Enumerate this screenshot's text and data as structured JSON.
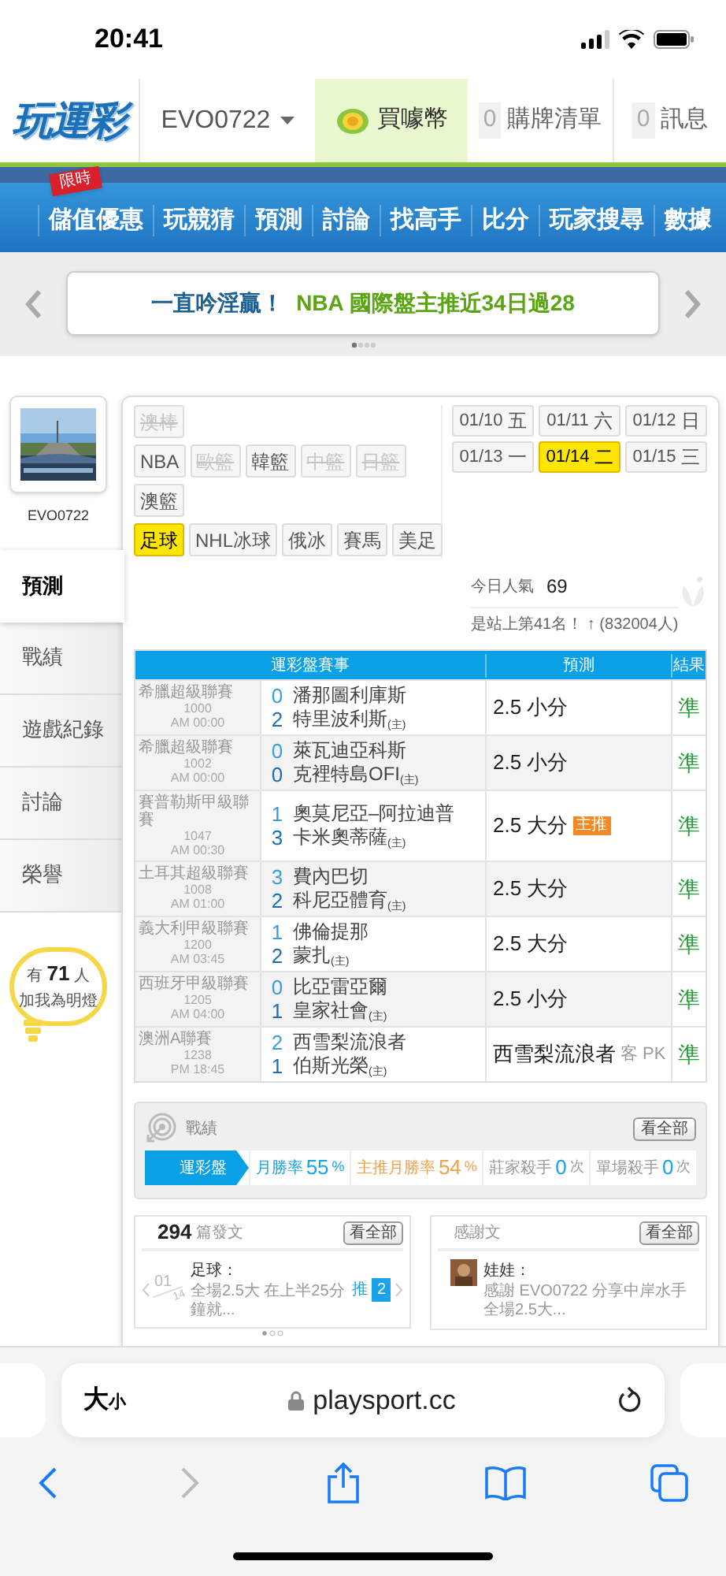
{
  "status_bar": {
    "time": "20:41"
  },
  "header": {
    "logo": "玩運彩",
    "user": "EVO0722",
    "buy": "買噱幣",
    "cart": {
      "count": "0",
      "label": "購牌清單"
    },
    "messages": {
      "count": "0",
      "label": "訊息"
    }
  },
  "nav": {
    "badge": "限時",
    "items": [
      "儲值優惠",
      "玩競猜",
      "預測",
      "討論",
      "找高手",
      "比分",
      "玩家搜尋",
      "數據"
    ]
  },
  "banner": {
    "lead": "一直吟淫贏！",
    "text": "NBA 國際盤主推近34日過28"
  },
  "profile": {
    "name": "EVO0722"
  },
  "sidebar": {
    "items": [
      {
        "label": "預測",
        "selected": true
      },
      {
        "label": "戰績",
        "selected": false
      },
      {
        "label": "遊戲紀錄",
        "selected": false
      },
      {
        "label": "討論",
        "selected": false
      },
      {
        "label": "榮譽",
        "selected": false
      }
    ],
    "fans": {
      "prefix": "有",
      "count": "71",
      "suffix": "人",
      "line2": "加我為明燈"
    }
  },
  "sports": {
    "rows": [
      [
        {
          "label": "澳棒",
          "disabled": true,
          "selected": false
        }
      ],
      [
        {
          "label": "NBA",
          "disabled": false,
          "selected": false
        },
        {
          "label": "歐籃",
          "disabled": true,
          "selected": false
        },
        {
          "label": "韓籃",
          "disabled": false,
          "selected": false
        },
        {
          "label": "中籃",
          "disabled": true,
          "selected": false
        },
        {
          "label": "日籃",
          "disabled": true,
          "selected": false
        }
      ],
      [
        {
          "label": "澳籃",
          "disabled": false,
          "selected": false
        }
      ],
      [
        {
          "label": "足球",
          "disabled": false,
          "selected": true
        },
        {
          "label": "NHL冰球",
          "disabled": false,
          "selected": false
        },
        {
          "label": "俄冰",
          "disabled": false,
          "selected": false
        },
        {
          "label": "賽馬",
          "disabled": false,
          "selected": false
        },
        {
          "label": "美足",
          "disabled": false,
          "selected": false
        }
      ]
    ]
  },
  "dates": [
    {
      "date": "01/10",
      "day": "五",
      "selected": false
    },
    {
      "date": "01/11",
      "day": "六",
      "selected": false
    },
    {
      "date": "01/12",
      "day": "日",
      "selected": false
    },
    {
      "date": "01/13",
      "day": "一",
      "selected": false
    },
    {
      "date": "01/14",
      "day": "二",
      "selected": true
    },
    {
      "date": "01/15",
      "day": "三",
      "selected": false
    }
  ],
  "popularity": {
    "label": "今日人氣",
    "value": "69",
    "rank": "是站上第41名！ ↑ (832004人)"
  },
  "table": {
    "columns": [
      "運彩盤賽事",
      "預測",
      "結果"
    ],
    "rows": [
      {
        "league": "希臘超級聯賽",
        "code": "1000",
        "time": "AM 00:00",
        "scores": [
          "0",
          "2"
        ],
        "teams": [
          "潘那圖利庫斯",
          "特里波利斯$_{(主)}$"
        ],
        "pick": "2.5 小分",
        "result": "準"
      },
      {
        "league": "希臘超級聯賽",
        "code": "1002",
        "time": "AM 00:00",
        "scores": [
          "0",
          "0"
        ],
        "teams": [
          "萊瓦迪亞科斯",
          "克裡特島OFI$_{(主)}$"
        ],
        "pick": "2.5 小分",
        "result": "準"
      },
      {
        "league": "賽普勒斯甲級聯賽",
        "code": "1047",
        "time": "AM 00:30",
        "scores": [
          "1",
          "3"
        ],
        "teams": [
          "奧莫尼亞–阿拉迪普",
          "卡米奧蒂薩$_{(主)}$"
        ],
        "pick": "2.5 大分",
        "badge": "主推",
        "result": "準"
      },
      {
        "league": "土耳其超級聯賽",
        "code": "1008",
        "time": "AM 01:00",
        "scores": [
          "3",
          "2"
        ],
        "teams": [
          "費內巴切",
          "科尼亞體育$_{(主)}$"
        ],
        "pick": "2.5 大分",
        "result": "準"
      },
      {
        "league": "義大利甲級聯賽",
        "code": "1200",
        "time": "AM 03:45",
        "scores": [
          "1",
          "2"
        ],
        "teams": [
          "佛倫提那",
          "蒙扎$_{(主)}$"
        ],
        "pick": "2.5 大分",
        "result": "準"
      },
      {
        "league": "西班牙甲級聯賽",
        "code": "1205",
        "time": "AM 04:00",
        "scores": [
          "0",
          "1"
        ],
        "teams": [
          "比亞雷亞爾",
          "皇家社會$_{(主)}$"
        ],
        "pick": "2.5 小分",
        "result": "準"
      },
      {
        "league": "澳洲A聯賽",
        "code": "1238",
        "time": "PM 18:45",
        "scores": [
          "2",
          "1"
        ],
        "teams": [
          "西雪梨流浪者",
          "伯斯光榮$_{(主)}$"
        ],
        "pick": "西雪梨流浪者",
        "note": "客 PK",
        "result": "準"
      }
    ]
  },
  "record": {
    "title": "戰績",
    "view_all": "看全部",
    "tab": "運彩盤",
    "stats": [
      {
        "kind": "highlight",
        "label": "月勝率",
        "value": "55",
        "unit": "%",
        "color": "#1aa3e8"
      },
      {
        "kind": "highlight",
        "label": "主推月勝率",
        "value": "54",
        "unit": "%",
        "color": "#f5a04a"
      },
      {
        "kind": "plain",
        "label": "莊家殺手",
        "value": "0",
        "unit": "次",
        "color": "#1aa3e8"
      },
      {
        "kind": "plain",
        "label": "單場殺手",
        "value": "0",
        "unit": "次",
        "color": "#1aa3e8"
      }
    ]
  },
  "posts": {
    "count": "294",
    "label": "篇發文",
    "view_all": "看全部",
    "item": {
      "month": "01",
      "day": "14",
      "title": "足球：",
      "text": "全場2.5大 在上半25分鐘就...",
      "push_label": "推",
      "push_count": "2"
    }
  },
  "thanks": {
    "label": "感謝文",
    "view_all": "看全部",
    "item": {
      "author": "娃娃：",
      "text": "感謝 EVO0722 分享中岸水手全場2.5大..."
    }
  },
  "browser": {
    "text_size": {
      "big": "大",
      "small": "小"
    },
    "url": "playsport.cc"
  }
}
